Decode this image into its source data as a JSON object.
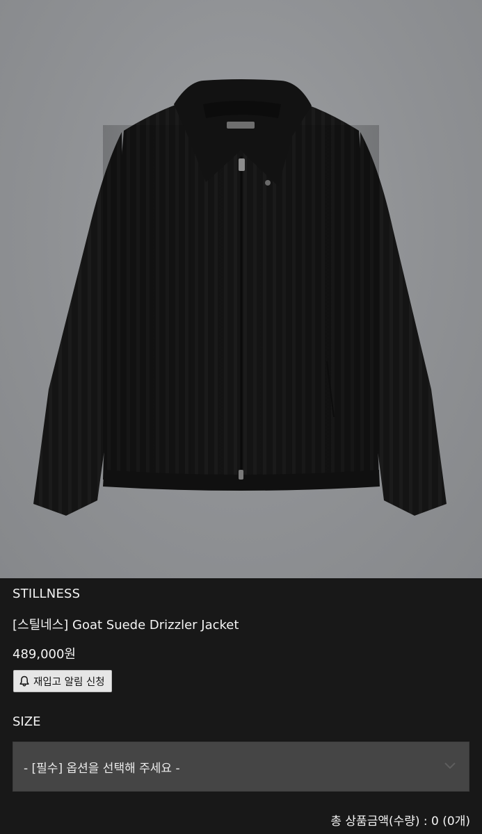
{
  "product": {
    "brand": "STILLNESS",
    "title": "[스틸네스] Goat Suede Drizzler Jacket",
    "price": "489,000원",
    "image_icon": "jacket-photo"
  },
  "restock": {
    "label": "재입고 알림 신청",
    "icon": "bell-icon"
  },
  "size": {
    "label": "SIZE",
    "select_placeholder": "- [필수] 옵션을 선택해 주세요 -",
    "icon": "chevron-down-icon"
  },
  "total": {
    "text": "총 상품금액(수량) : 0 (0개)"
  },
  "colors": {
    "background": "#181818",
    "photo_backdrop": "#8f9194",
    "select_bg": "#454545",
    "button_bg": "#e6e6e6"
  }
}
